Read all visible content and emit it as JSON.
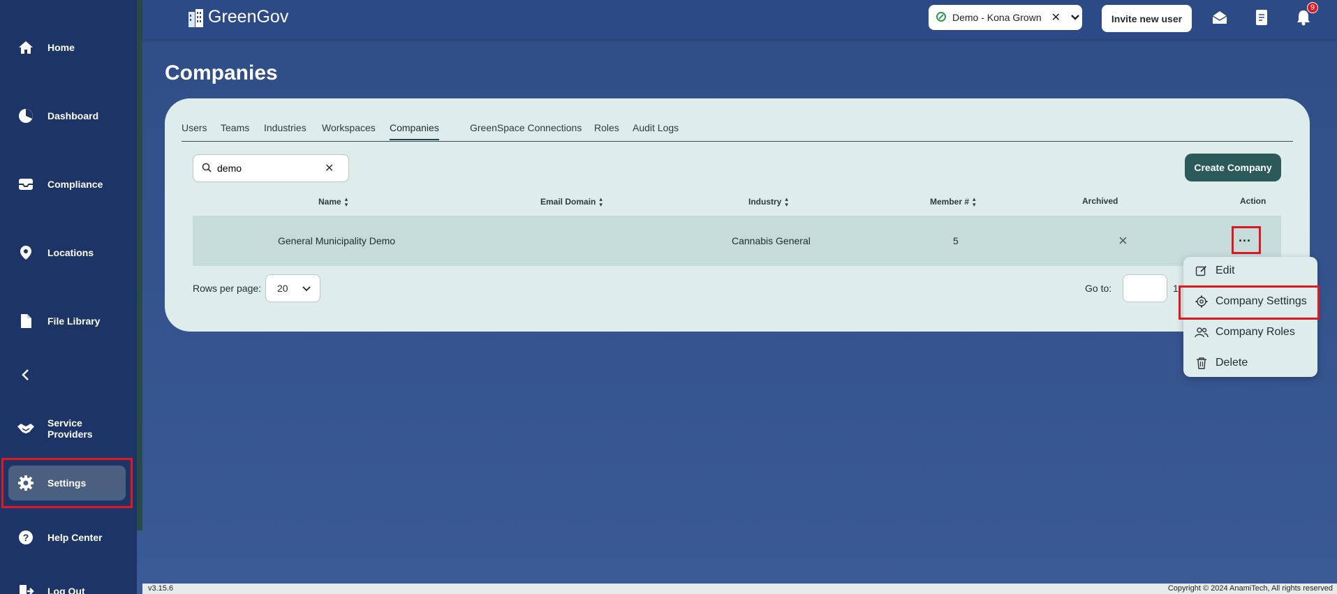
{
  "app": {
    "logo_text": "GreenGov",
    "page_title": "Companies",
    "version": "v3.15.6",
    "copyright": "Copyright © 2024 AnamiTech, All rights reserved"
  },
  "sidebar": {
    "items": [
      {
        "label": "Home",
        "icon": "home-icon"
      },
      {
        "label": "Dashboard",
        "icon": "pie-chart-icon"
      },
      {
        "label": "Compliance",
        "icon": "inbox-icon"
      },
      {
        "label": "Locations",
        "icon": "location-pin-icon"
      },
      {
        "label": "File Library",
        "icon": "file-icon"
      },
      {
        "label": "Service Providers",
        "icon": "handshake-icon"
      },
      {
        "label": "Settings",
        "icon": "gear-icon"
      },
      {
        "label": "Help Center",
        "icon": "help-icon"
      },
      {
        "label": "Log Out",
        "icon": "logout-icon"
      }
    ]
  },
  "topbar": {
    "workspace": "Demo - Kona Grown",
    "invite_label": "Invite new user",
    "notification_count": "9"
  },
  "tabs": [
    "Users",
    "Teams",
    "Industries",
    "Workspaces",
    "Companies",
    "GreenSpace Connections",
    "Roles",
    "Audit Logs"
  ],
  "active_tab": "Companies",
  "search": {
    "value": "demo"
  },
  "create_label": "Create Company",
  "table": {
    "columns": [
      "Name",
      "Email Domain",
      "Industry",
      "Member #",
      "Archived",
      "Action"
    ],
    "rows": [
      {
        "name": "General Municipality Demo",
        "email_domain": "",
        "industry": "Cannabis General",
        "members": "5",
        "archived": "×",
        "action": "···"
      }
    ]
  },
  "pagination": {
    "rows_per_page_label": "Rows per page:",
    "rows_per_page": "20",
    "goto_label": "Go to:",
    "page": "1"
  },
  "menu": {
    "items": [
      {
        "label": "Edit",
        "icon": "edit-icon"
      },
      {
        "label": "Company Settings",
        "icon": "gear-icon"
      },
      {
        "label": "Company Roles",
        "icon": "users-icon"
      },
      {
        "label": "Delete",
        "icon": "trash-icon"
      }
    ]
  },
  "colors": {
    "sidebar": "#1d3466",
    "background": "#2f4d86",
    "card": "#deecec",
    "primary_button": "#2c5a5a",
    "highlight": "#e0171e"
  }
}
